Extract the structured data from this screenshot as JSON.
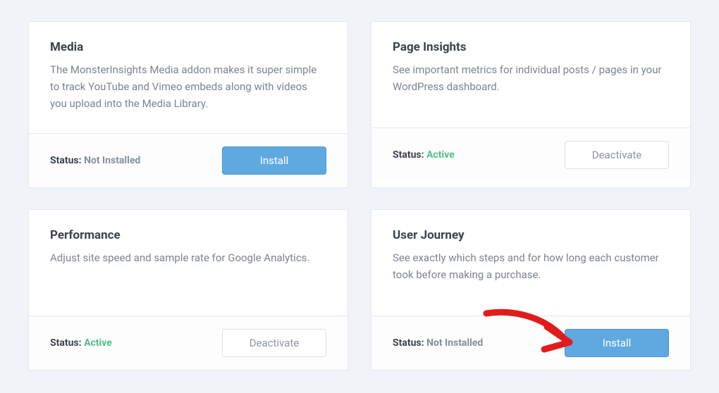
{
  "statusLabel": "Status:",
  "buttons": {
    "install": "Install",
    "deactivate": "Deactivate"
  },
  "statusValues": {
    "active": "Active",
    "notInstalled": "Not Installed"
  },
  "cards": {
    "media": {
      "title": "Media",
      "desc": "The MonsterInsights Media addon makes it super simple to track YouTube and Vimeo embeds along with videos you upload into the Media Library."
    },
    "pageInsights": {
      "title": "Page Insights",
      "desc": "See important metrics for individual posts / pages in your WordPress dashboard."
    },
    "performance": {
      "title": "Performance",
      "desc": "Adjust site speed and sample rate for Google Analytics."
    },
    "userJourney": {
      "title": "User Journey",
      "desc": "See exactly which steps and for how long each customer took before making a purchase."
    }
  },
  "annotation": {
    "arrowColor": "#e21b1b"
  }
}
